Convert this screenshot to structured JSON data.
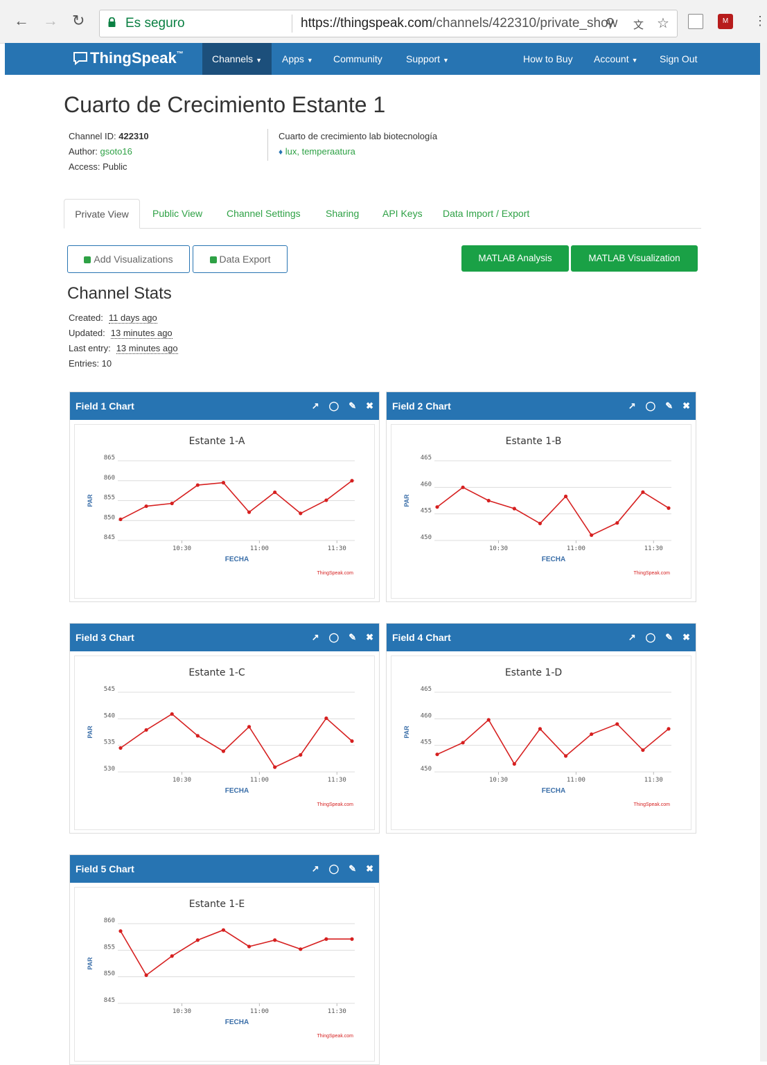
{
  "browser": {
    "secure_label": "Es seguro",
    "url_host": "https://thingspeak.com",
    "url_path": "/channels/422310/private_show"
  },
  "navbar": {
    "brand": "ThingSpeak",
    "brand_tm": "™",
    "items": [
      "Channels",
      "Apps",
      "Community",
      "Support",
      "How to Buy",
      "Account",
      "Sign Out"
    ]
  },
  "channel": {
    "title": "Cuarto de Crecimiento Estante 1",
    "id_label": "Channel ID:",
    "id": "422310",
    "author_label": "Author:",
    "author": "gsoto16",
    "access": "Access: Public",
    "description": "Cuarto de crecimiento lab biotecnología",
    "tags": "lux, temperaatura"
  },
  "tabs": [
    "Private View",
    "Public View",
    "Channel Settings",
    "Sharing",
    "API Keys",
    "Data Import / Export"
  ],
  "buttons": {
    "add_viz": "Add Visualizations",
    "data_export": "Data Export",
    "matlab_analysis": "MATLAB Analysis",
    "matlab_viz": "MATLAB Visualization"
  },
  "stats": {
    "title": "Channel Stats",
    "created_label": "Created:",
    "created": "11 days ago",
    "updated_label": "Updated:",
    "updated": "13 minutes ago",
    "last_label": "Last entry:",
    "last": "13 minutes ago",
    "entries": "Entries: 10"
  },
  "panels": [
    {
      "title": "Field 1 Chart"
    },
    {
      "title": "Field 2 Chart"
    },
    {
      "title": "Field 3 Chart"
    },
    {
      "title": "Field 4 Chart"
    },
    {
      "title": "Field 5 Chart"
    }
  ],
  "colors": {
    "navbar": "#2774b2",
    "accent_green": "#1aa146",
    "line": "#d62020"
  },
  "chart_data": [
    {
      "type": "line",
      "title": "Estante 1-A",
      "xlabel": "FECHA",
      "ylabel": "PAR",
      "credit": "ThingSpeak.com",
      "yticks": [
        845,
        850,
        855,
        860,
        865
      ],
      "ylim": [
        845,
        865
      ],
      "xticks": [
        "10:30",
        "11:00",
        "11:30"
      ],
      "series": [
        {
          "values": [
            850.3,
            853.6,
            854.3,
            858.9,
            859.5,
            852.1,
            857.1,
            851.8,
            855.1,
            860.0
          ]
        }
      ]
    },
    {
      "type": "line",
      "title": "Estante 1-B",
      "xlabel": "FECHA",
      "ylabel": "PAR",
      "credit": "ThingSpeak.com",
      "yticks": [
        450,
        455,
        460,
        465
      ],
      "ylim": [
        450,
        465
      ],
      "xticks": [
        "10:30",
        "11:00",
        "11:30"
      ],
      "series": [
        {
          "values": [
            456.3,
            460.0,
            457.5,
            456.0,
            453.2,
            458.3,
            451.0,
            453.3,
            459.1,
            456.1
          ]
        }
      ]
    },
    {
      "type": "line",
      "title": "Estante 1-C",
      "xlabel": "FECHA",
      "ylabel": "PAR",
      "credit": "ThingSpeak.com",
      "yticks": [
        530,
        535,
        540,
        545
      ],
      "ylim": [
        530,
        545
      ],
      "xticks": [
        "10:30",
        "11:00",
        "11:30"
      ],
      "series": [
        {
          "values": [
            534.5,
            537.9,
            540.9,
            536.8,
            533.9,
            538.5,
            530.9,
            533.2,
            540.1,
            535.8
          ]
        }
      ]
    },
    {
      "type": "line",
      "title": "Estante 1-D",
      "xlabel": "FECHA",
      "ylabel": "PAR",
      "credit": "ThingSpeak.com",
      "yticks": [
        450,
        455,
        460,
        465
      ],
      "ylim": [
        450,
        465
      ],
      "xticks": [
        "10:30",
        "11:00",
        "11:30"
      ],
      "series": [
        {
          "values": [
            453.3,
            455.5,
            459.8,
            451.5,
            458.1,
            453.0,
            457.1,
            459.0,
            454.1,
            458.1
          ]
        }
      ]
    },
    {
      "type": "line",
      "title": "Estante 1-E",
      "xlabel": "FECHA",
      "ylabel": "PAR",
      "credit": "ThingSpeak.com",
      "yticks": [
        845,
        850,
        855,
        860
      ],
      "ylim": [
        845,
        860
      ],
      "xticks": [
        "10:30",
        "11:00",
        "11:30"
      ],
      "series": [
        {
          "values": [
            858.6,
            850.3,
            853.9,
            856.9,
            858.8,
            855.7,
            856.9,
            855.2,
            857.1,
            857.1
          ]
        }
      ]
    }
  ]
}
